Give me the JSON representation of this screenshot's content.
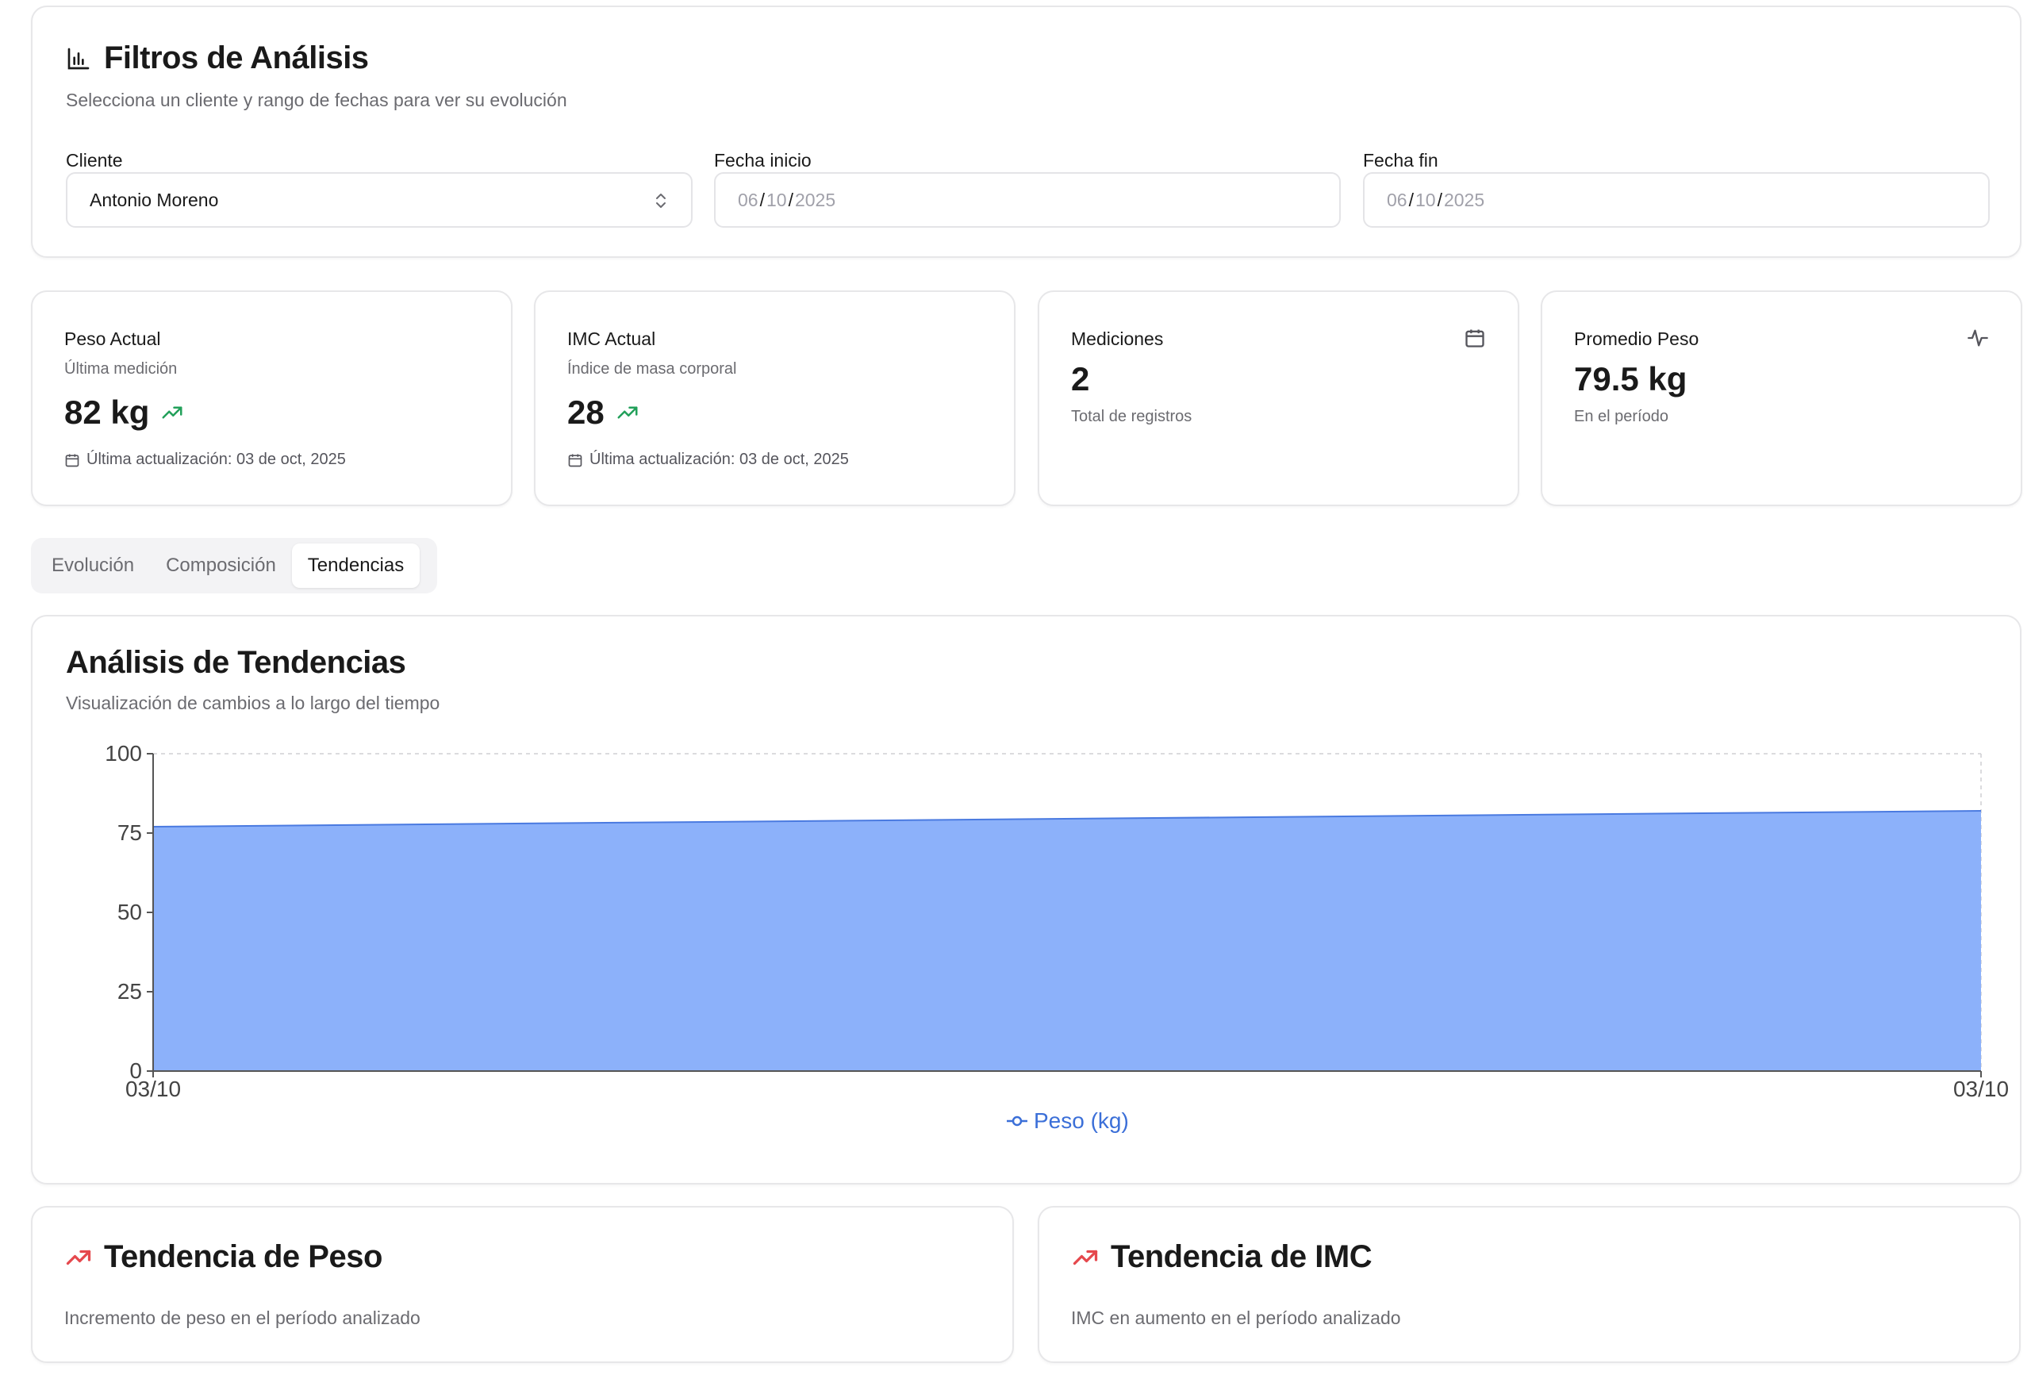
{
  "filters": {
    "title": "Filtros de Análisis",
    "subtitle": "Selecciona un cliente y rango de fechas para ver su evolución",
    "client_label": "Cliente",
    "client_value": "Antonio Moreno",
    "start_label": "Fecha inicio",
    "start_date": {
      "dd": "06",
      "mm": "10",
      "yyyy": "2025"
    },
    "end_label": "Fecha fin",
    "end_date": {
      "dd": "06",
      "mm": "10",
      "yyyy": "2025"
    }
  },
  "stats": {
    "weight": {
      "title": "Peso Actual",
      "subtitle": "Última medición",
      "value": "82 kg",
      "footer": "Última actualización: 03 de oct, 2025"
    },
    "bmi": {
      "title": "IMC Actual",
      "subtitle": "Índice de masa corporal",
      "value": "28",
      "footer": "Última actualización: 03 de oct, 2025"
    },
    "measurements": {
      "title": "Mediciones",
      "value": "2",
      "subtitle": "Total de registros",
      "icon": "calendar-icon"
    },
    "avg_weight": {
      "title": "Promedio Peso",
      "value": "79.5 kg",
      "subtitle": "En el período",
      "icon": "activity-icon"
    }
  },
  "tabs": [
    {
      "label": "Evolución",
      "active": false
    },
    {
      "label": "Composición",
      "active": false
    },
    {
      "label": "Tendencias",
      "active": true
    }
  ],
  "chart": {
    "title": "Análisis de Tendencias",
    "subtitle": "Visualización de cambios a lo largo del tiempo"
  },
  "chart_data": {
    "type": "area",
    "x": [
      "03/10",
      "03/10"
    ],
    "series": [
      {
        "name": "Peso (kg)",
        "values": [
          77,
          82
        ],
        "color": "#7ea6f7"
      }
    ],
    "ylim": [
      0,
      100
    ],
    "yticks": [
      0,
      25,
      50,
      75,
      100
    ],
    "grid": true,
    "legend": "bottom-center"
  },
  "trends": {
    "weight": {
      "title": "Tendencia de Peso",
      "subtitle": "Incremento de peso en el período analizado",
      "icon": "trending-up-icon"
    },
    "bmi": {
      "title": "Tendencia de IMC",
      "subtitle": "IMC en aumento en el período analizado",
      "icon": "trending-up-icon"
    }
  },
  "colors": {
    "trend_up_green": "#22a05a",
    "trend_up_red": "#e5484d",
    "chart_fill": "#8cb1fa",
    "chart_line": "#4a7ae0",
    "legend_blue": "#3b6fd8"
  }
}
